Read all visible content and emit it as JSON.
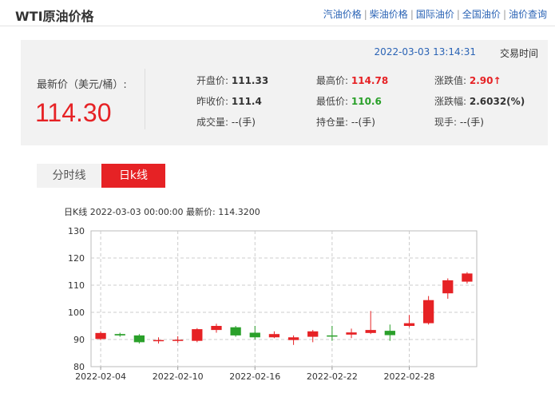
{
  "header": {
    "title": "WTI原油价格",
    "nav": [
      "汽油价格",
      "柴油价格",
      "国际油价",
      "全国油价",
      "油价查询"
    ]
  },
  "quote": {
    "datetime": "2022-03-03 13:14:31",
    "trade_time_label": "交易时间",
    "latest_label": "最新价（美元/桶）:",
    "latest_value": "114.30",
    "open_label": "开盘价:",
    "open_value": "111.33",
    "prev_close_label": "昨收价:",
    "prev_close_value": "111.4",
    "volume_label": "成交量:",
    "volume_value": "--(手)",
    "high_label": "最高价:",
    "high_value": "114.78",
    "low_label": "最低价:",
    "low_value": "110.6",
    "open_interest_label": "持仓量:",
    "open_interest_value": "--(手)",
    "change_label": "涨跌值:",
    "change_value": "2.90↑",
    "change_pct_label": "涨跌幅:",
    "change_pct_value": "2.6032(%)",
    "current_hand_label": "现手:",
    "current_hand_value": "--(手)"
  },
  "tabs": [
    "分时线",
    "日k线"
  ],
  "chart_info": "日K线  2022-03-03 00:00:00  最新价: 114.3200",
  "colors": {
    "up": "#e62225",
    "down": "#2aa02a"
  },
  "chart_data": {
    "type": "candlestick",
    "ylim": [
      80,
      130
    ],
    "yticks": [
      80,
      90,
      100,
      110,
      120,
      130
    ],
    "xtick_labels": [
      {
        "index": 0,
        "label": "2022-02-04"
      },
      {
        "index": 4,
        "label": "2022-02-10"
      },
      {
        "index": 8,
        "label": "2022-02-16"
      },
      {
        "index": 12,
        "label": "2022-02-22"
      },
      {
        "index": 16,
        "label": "2022-02-28"
      }
    ],
    "candles": [
      {
        "open": 90.2,
        "close": 92.4,
        "high": 93.0,
        "low": 89.8
      },
      {
        "open": 92.0,
        "close": 91.5,
        "high": 92.5,
        "low": 91.0
      },
      {
        "open": 91.5,
        "close": 89.0,
        "high": 92.0,
        "low": 88.5
      },
      {
        "open": 89.5,
        "close": 89.8,
        "high": 90.8,
        "low": 88.5
      },
      {
        "open": 89.5,
        "close": 89.9,
        "high": 91.2,
        "low": 88.8
      },
      {
        "open": 89.5,
        "close": 93.8,
        "high": 94.2,
        "low": 89.0
      },
      {
        "open": 93.5,
        "close": 95.0,
        "high": 95.8,
        "low": 92.5
      },
      {
        "open": 94.5,
        "close": 91.5,
        "high": 95.0,
        "low": 91.0
      },
      {
        "open": 92.5,
        "close": 90.8,
        "high": 95.0,
        "low": 90.0
      },
      {
        "open": 90.8,
        "close": 92.0,
        "high": 93.0,
        "low": 90.5
      },
      {
        "open": 89.8,
        "close": 90.8,
        "high": 91.5,
        "low": 88.0
      },
      {
        "open": 91.0,
        "close": 93.0,
        "high": 93.5,
        "low": 89.0
      },
      {
        "open": 91.5,
        "close": 91.3,
        "high": 95.0,
        "low": 89.5
      },
      {
        "open": 91.8,
        "close": 92.6,
        "high": 94.0,
        "low": 90.5
      },
      {
        "open": 92.4,
        "close": 93.5,
        "high": 100.5,
        "low": 92.0
      },
      {
        "open": 93.2,
        "close": 91.6,
        "high": 95.5,
        "low": 89.5
      },
      {
        "open": 95.0,
        "close": 96.0,
        "high": 99.0,
        "low": 94.5
      },
      {
        "open": 96.0,
        "close": 104.5,
        "high": 106.0,
        "low": 95.5
      },
      {
        "open": 107.0,
        "close": 111.8,
        "high": 112.5,
        "low": 105.0
      },
      {
        "open": 111.3,
        "close": 114.3,
        "high": 114.8,
        "low": 110.6
      }
    ]
  }
}
